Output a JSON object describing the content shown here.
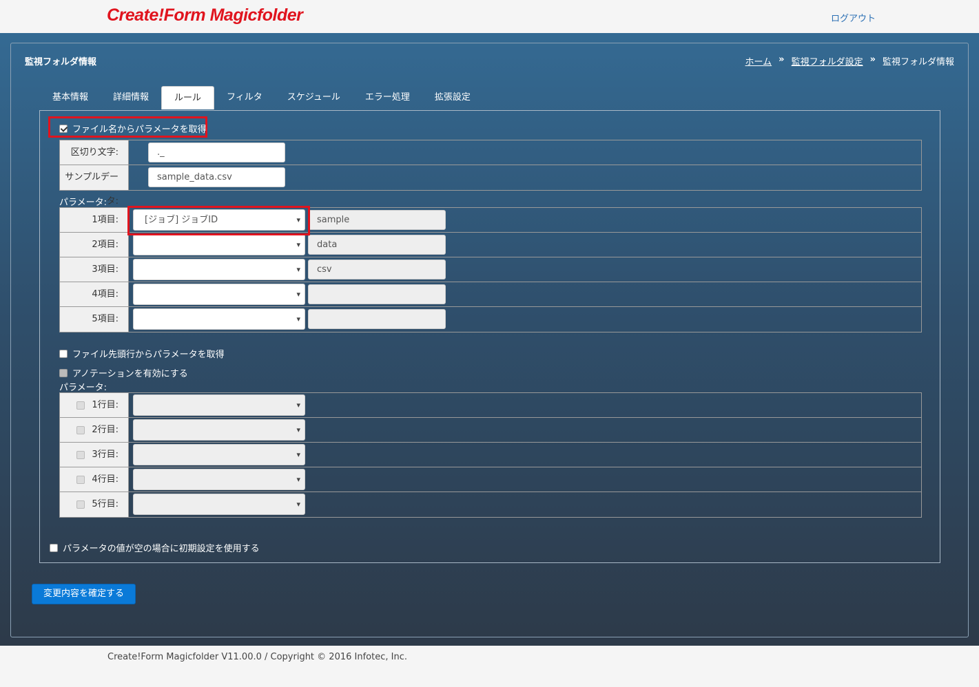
{
  "header": {
    "logo": "Create!Form Magicfolder",
    "logout": "ログアウト"
  },
  "panel": {
    "title": "監視フォルダ情報",
    "breadcrumb": [
      "ホーム",
      "監視フォルダ設定",
      "監視フォルダ情報"
    ],
    "breadcrumb_sep": "»"
  },
  "tabs": [
    "基本情報",
    "詳細情報",
    "ルール",
    "フィルタ",
    "スケジュール",
    "エラー処理",
    "拡張設定"
  ],
  "active_tab": "ルール",
  "filename_section": {
    "checkbox_label": "ファイル名からパラメータを取得",
    "checked": true,
    "rows": [
      {
        "label": "区切り文字:",
        "value": "._"
      },
      {
        "label": "サンプルデータ:",
        "value": "sample_data.csv"
      }
    ],
    "params_label": "パラメータ:",
    "params": [
      {
        "label": "1項目:",
        "select": "[ジョブ] ジョブID",
        "value": "sample"
      },
      {
        "label": "2項目:",
        "select": "",
        "value": "data"
      },
      {
        "label": "3項目:",
        "select": "",
        "value": "csv"
      },
      {
        "label": "4項目:",
        "select": "",
        "value": ""
      },
      {
        "label": "5項目:",
        "select": "",
        "value": ""
      }
    ]
  },
  "firstline_section": {
    "checkbox_label": "ファイル先頭行からパラメータを取得",
    "checked": false,
    "annotation_label": "アノテーションを有効にする",
    "params_label": "パラメータ:",
    "lines": [
      {
        "label": "1行目:",
        "select": ""
      },
      {
        "label": "2行目:",
        "select": ""
      },
      {
        "label": "3行目:",
        "select": ""
      },
      {
        "label": "4行目:",
        "select": ""
      },
      {
        "label": "5行目:",
        "select": ""
      }
    ]
  },
  "default_option": {
    "label": "パラメータの値が空の場合に初期設定を使用する",
    "checked": false
  },
  "submit_label": "変更内容を確定する",
  "footer": "Create!Form Magicfolder V11.00.0 / Copyright © 2016 Infotec, Inc.",
  "colors": {
    "logo": "#e0141e",
    "highlight": "#e0141e",
    "submit": "#0a7ad8"
  }
}
